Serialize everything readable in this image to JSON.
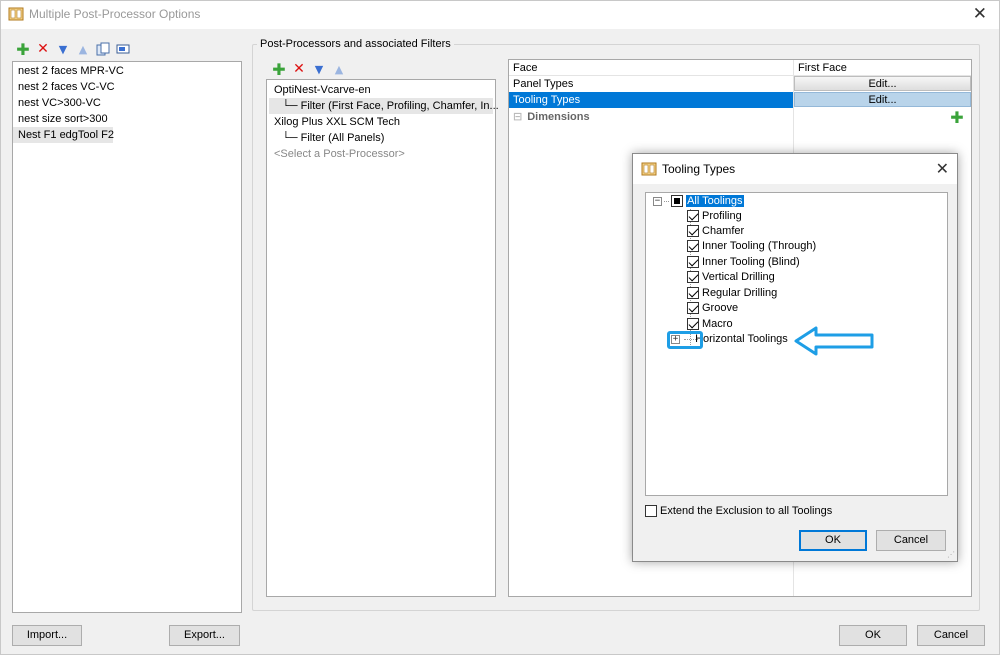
{
  "window": {
    "title": "Multiple Post-Processor Options",
    "close_glyph": "✕"
  },
  "left_toolbar_icons": [
    "add-icon",
    "delete-icon",
    "move-down-icon",
    "move-up-icon",
    "copy-icon",
    "rename-icon"
  ],
  "configurations": [
    "nest 2 faces MPR-VC",
    "nest 2 faces VC-VC",
    "nest VC>300-VC",
    "nest size sort>300",
    "Nest F1 edgTool F2"
  ],
  "post_processors": {
    "group_label": "Post-Processors and associated Filters",
    "tree": [
      {
        "text": "OptiNest-Vcarve-en"
      },
      {
        "text": "└─ Filter (First Face, Profiling, Chamfer, In..."
      },
      {
        "text": "Xilog Plus XXL SCM Tech"
      },
      {
        "text": "└─ Filter (All Panels)"
      },
      {
        "text": "<Select a Post-Processor>"
      }
    ]
  },
  "filter_grid": {
    "col1_header": "Face",
    "col2_header": "First Face",
    "rows": [
      {
        "label": "Panel Types",
        "value": "Edit..."
      },
      {
        "label": "Tooling Types",
        "value": "Edit..."
      }
    ],
    "section_label": "Dimensions",
    "section_glyph": "⊟"
  },
  "buttons": {
    "import": "Import...",
    "export": "Export...",
    "ok": "OK",
    "cancel": "Cancel"
  },
  "dialog": {
    "title": "Tooling Types",
    "close_glyph": "✕",
    "root": "All Toolings",
    "children": [
      "Profiling",
      "Chamfer",
      "Inner Tooling (Through)",
      "Inner Tooling (Blind)",
      "Vertical Drilling",
      "Regular Drilling",
      "Groove",
      "Macro"
    ],
    "collapsed_node": "Horizontal Toolings",
    "extend_checkbox": "Extend the Exclusion to all Toolings",
    "ok": "OK",
    "cancel": "Cancel"
  },
  "colors": {
    "selection": "#0078d7",
    "annotation": "#1e9ee6"
  }
}
